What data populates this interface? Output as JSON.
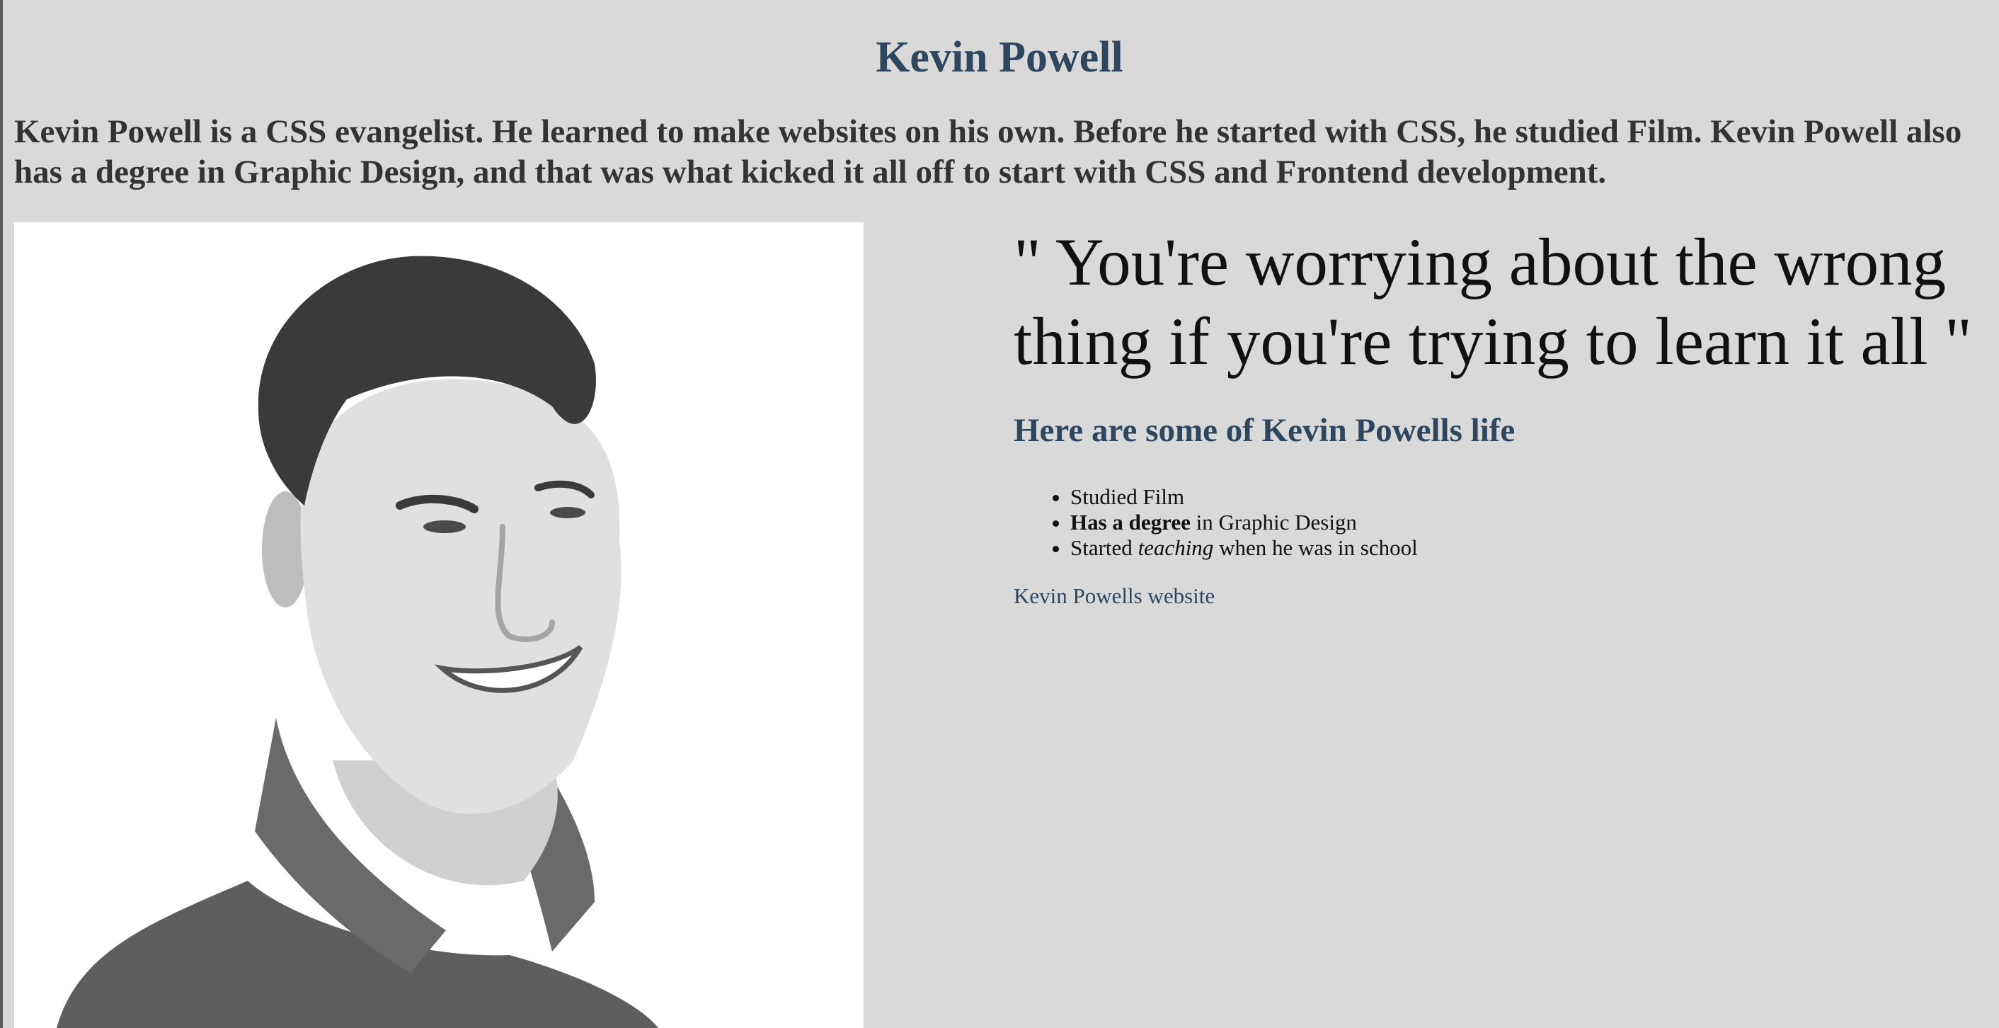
{
  "header": {
    "title": "Kevin Powell"
  },
  "intro": {
    "text": "Kevin Powell is a CSS evangelist. He learned to make websites on his own. Before he started with CSS, he studied Film. Kevin Powell also has a degree in Graphic Design, and that was what kicked it all off to start with CSS and Frontend development."
  },
  "quote": {
    "text": "\" You're worrying about the wrong thing if you're trying to learn it all \""
  },
  "life": {
    "heading": "Here are some of Kevin Powells life",
    "items": [
      {
        "text": "Studied Film"
      },
      {
        "bold": "Has a degree",
        "rest": " in Graphic Design"
      },
      {
        "before": "Started ",
        "italic": "teaching",
        "after": " when he was in school"
      }
    ]
  },
  "link": {
    "label": "Kevin Powells website"
  },
  "colors": {
    "background": "#d9d9d9",
    "accent": "#2e475f",
    "intro_text": "#333333",
    "body_text": "#111111"
  }
}
